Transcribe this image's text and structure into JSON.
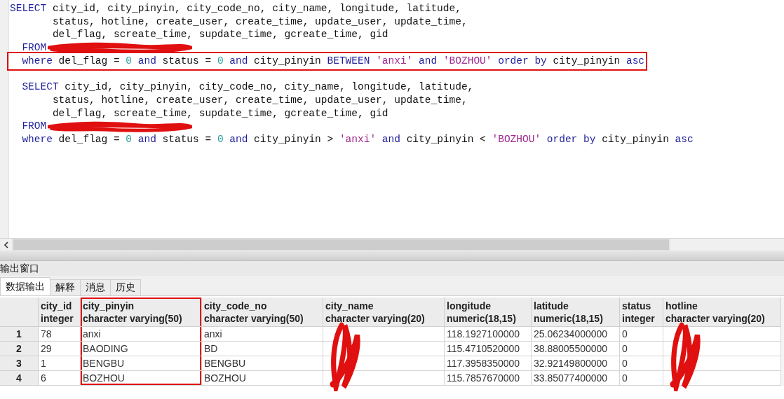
{
  "editor": {
    "blocks": [
      {
        "lines": [
          {
            "tokens": [
              {
                "kind": "keyword",
                "text": "SELECT"
              },
              {
                "kind": "plain",
                "text": " city_id, city_pinyin, city_code_no, city_name, longitude, latitude,"
              }
            ]
          },
          {
            "tokens": [
              {
                "kind": "plain",
                "text": "       status, hotline, create_user, create_time, update_user, update_time,"
              }
            ]
          },
          {
            "tokens": [
              {
                "kind": "plain",
                "text": "       del_flag, screate_time, supdate_time, gcreate_time, gid"
              }
            ]
          },
          {
            "tokens": [
              {
                "kind": "keyword",
                "text": "  FROM"
              }
            ],
            "redacted": true
          },
          {
            "tokens": [
              {
                "kind": "keyword",
                "text": "  where"
              },
              {
                "kind": "plain",
                "text": " del_flag = "
              },
              {
                "kind": "number",
                "text": "0 "
              },
              {
                "kind": "keyword",
                "text": "and"
              },
              {
                "kind": "plain",
                "text": " status = "
              },
              {
                "kind": "number",
                "text": "0 "
              },
              {
                "kind": "keyword",
                "text": "and"
              },
              {
                "kind": "plain",
                "text": " city_pinyin "
              },
              {
                "kind": "keyword",
                "text": "BETWEEN "
              },
              {
                "kind": "string",
                "text": "'anxi' "
              },
              {
                "kind": "keyword",
                "text": "and "
              },
              {
                "kind": "string",
                "text": "'BOZHOU' "
              },
              {
                "kind": "keyword",
                "text": "order by"
              },
              {
                "kind": "plain",
                "text": " city_pinyin "
              },
              {
                "kind": "keyword",
                "text": "asc"
              }
            ],
            "highlighted": true
          }
        ]
      },
      {
        "lines": [
          {
            "tokens": [
              {
                "kind": "keyword",
                "text": "  SELECT"
              },
              {
                "kind": "plain",
                "text": " city_id, city_pinyin, city_code_no, city_name, longitude, latitude,"
              }
            ]
          },
          {
            "tokens": [
              {
                "kind": "plain",
                "text": "       status, hotline, create_user, create_time, update_user, update_time,"
              }
            ]
          },
          {
            "tokens": [
              {
                "kind": "plain",
                "text": "       del_flag, screate_time, supdate_time, gcreate_time, gid"
              }
            ]
          },
          {
            "tokens": [
              {
                "kind": "keyword",
                "text": "  FROM"
              }
            ],
            "redacted": true
          },
          {
            "tokens": [
              {
                "kind": "keyword",
                "text": "  where"
              },
              {
                "kind": "plain",
                "text": " del_flag = "
              },
              {
                "kind": "number",
                "text": "0 "
              },
              {
                "kind": "keyword",
                "text": "and"
              },
              {
                "kind": "plain",
                "text": " status = "
              },
              {
                "kind": "number",
                "text": "0 "
              },
              {
                "kind": "keyword",
                "text": "and"
              },
              {
                "kind": "plain",
                "text": " city_pinyin > "
              },
              {
                "kind": "string",
                "text": "'anxi' "
              },
              {
                "kind": "keyword",
                "text": "and"
              },
              {
                "kind": "plain",
                "text": " city_pinyin < "
              },
              {
                "kind": "string",
                "text": "'BOZHOU' "
              },
              {
                "kind": "keyword",
                "text": "order by"
              },
              {
                "kind": "plain",
                "text": " city_pinyin "
              },
              {
                "kind": "keyword",
                "text": "asc"
              }
            ]
          }
        ]
      }
    ]
  },
  "output": {
    "title": "输出窗口",
    "tabs": [
      {
        "label": "数据输出",
        "selected": true
      },
      {
        "label": "解释",
        "selected": false
      },
      {
        "label": "消息",
        "selected": false
      },
      {
        "label": "历史",
        "selected": false
      }
    ],
    "table": {
      "columns": [
        {
          "name": "city_id",
          "type": "integer"
        },
        {
          "name": "city_pinyin",
          "type": "character varying(50)",
          "highlighted": true
        },
        {
          "name": "city_code_no",
          "type": "character varying(50)"
        },
        {
          "name": "city_name",
          "type": "character varying(20)",
          "redacted": true
        },
        {
          "name": "longitude",
          "type": "numeric(18,15)"
        },
        {
          "name": "latitude",
          "type": "numeric(18,15)"
        },
        {
          "name": "status",
          "type": "integer"
        },
        {
          "name": "hotline",
          "type": "character varying(20)",
          "redacted": true
        }
      ],
      "rows": [
        {
          "number": "1",
          "cells": [
            "78",
            "anxi",
            "anxi",
            "",
            "118.1927100000",
            "25.06234000000",
            "0",
            ""
          ]
        },
        {
          "number": "2",
          "cells": [
            "29",
            "BAODING",
            "BD",
            "",
            "115.4710520000",
            "38.88005500000",
            "0",
            ""
          ]
        },
        {
          "number": "3",
          "cells": [
            "1",
            "BENGBU",
            "BENGBU",
            "",
            "117.3958350000",
            "32.92149800000",
            "0",
            ""
          ]
        },
        {
          "number": "4",
          "cells": [
            "6",
            "BOZHOU",
            "BOZHOU",
            "",
            "115.7857670000",
            "33.85077400000",
            "0",
            ""
          ]
        }
      ]
    }
  }
}
